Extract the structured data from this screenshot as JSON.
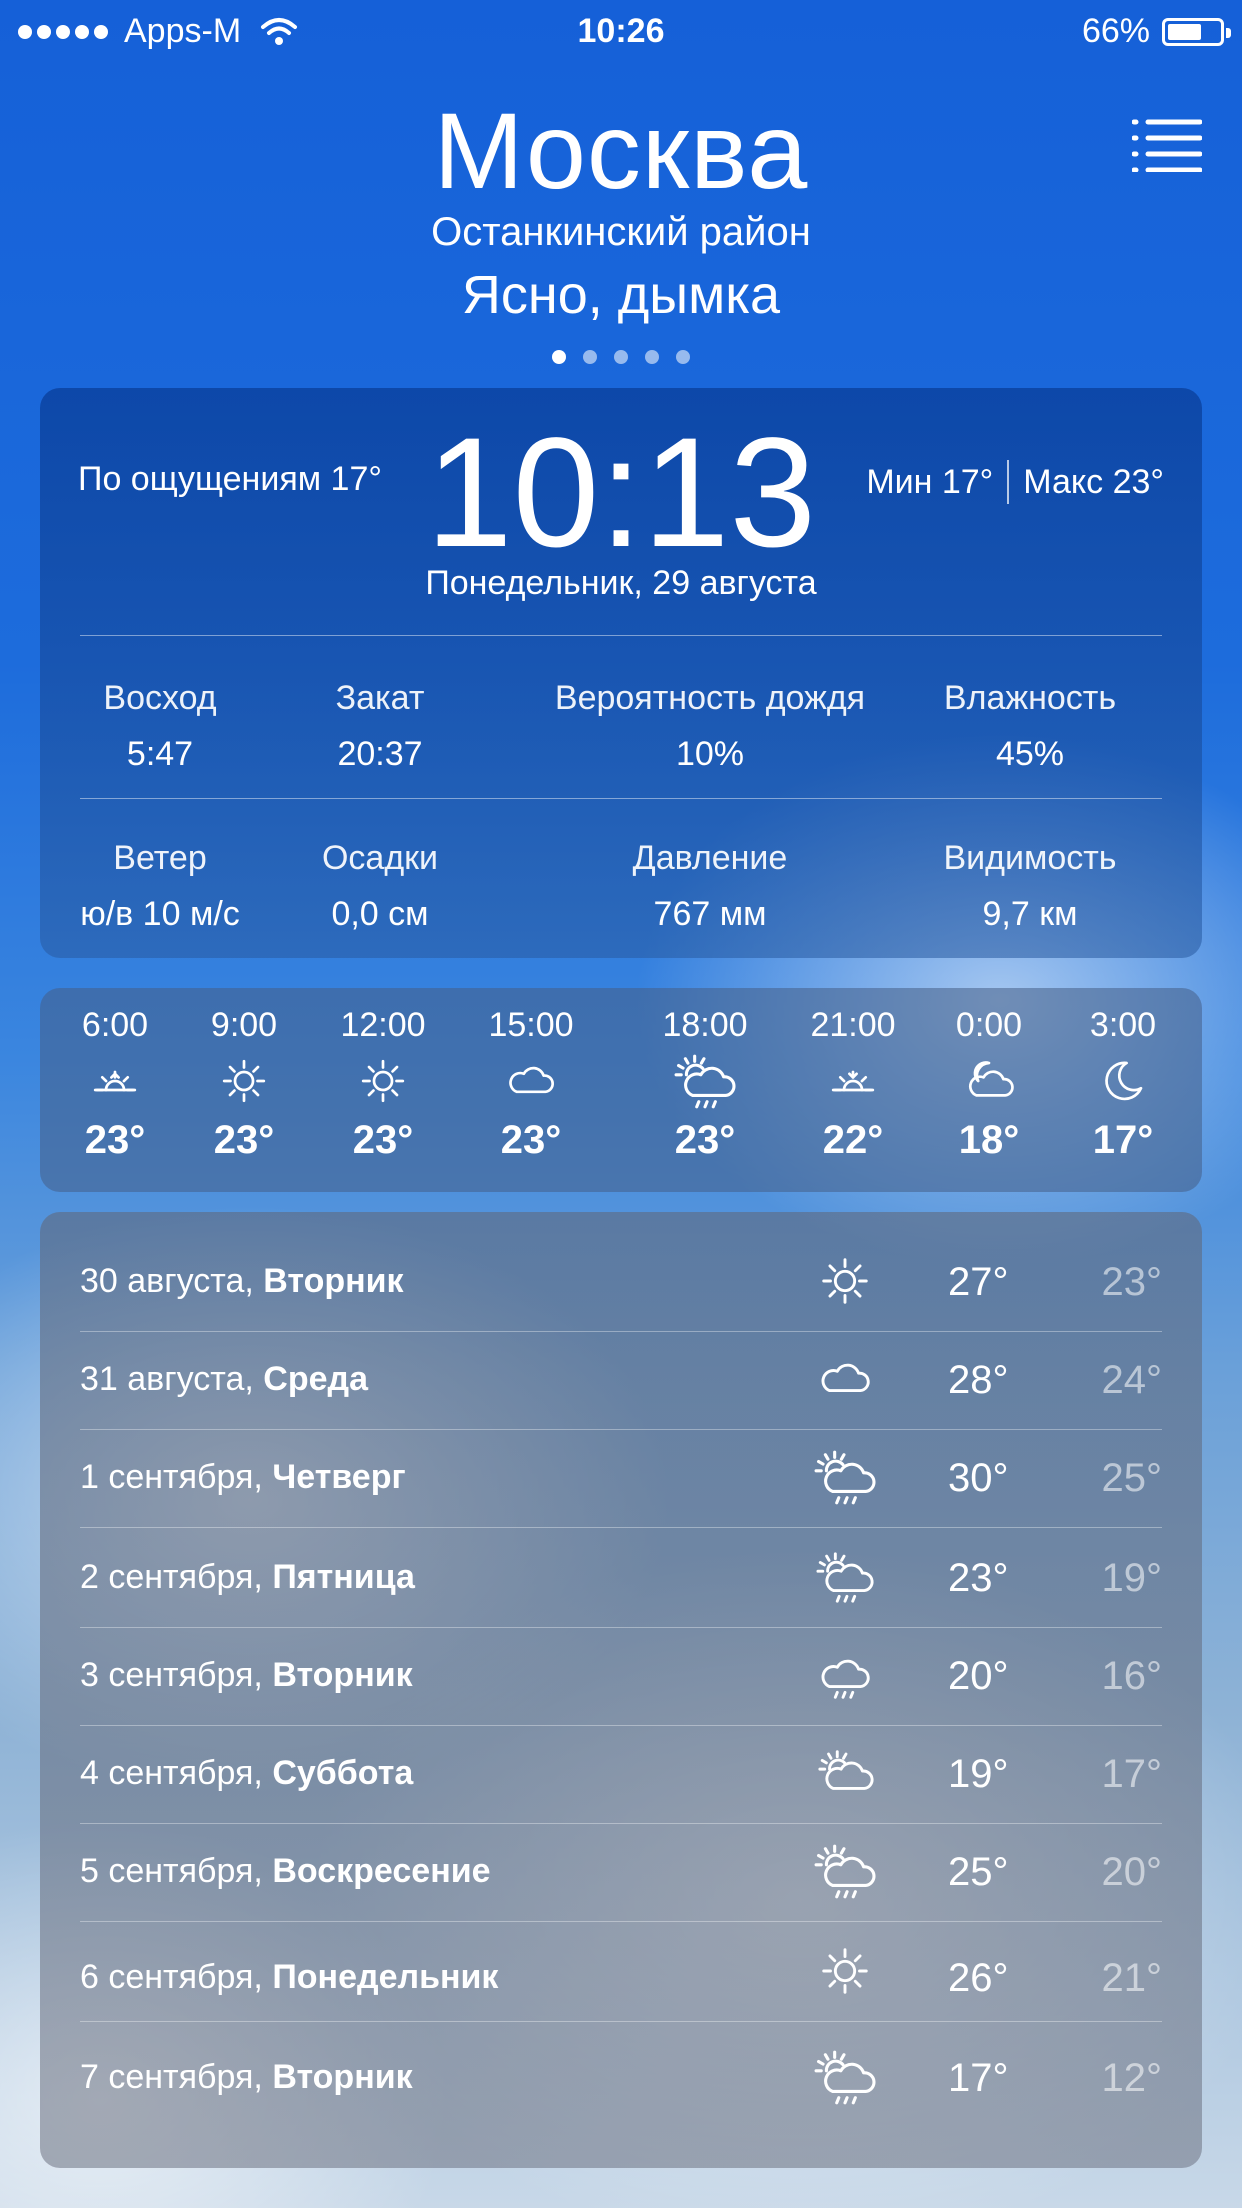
{
  "status_bar": {
    "carrier": "Apps-M",
    "time": "10:26",
    "battery": "66%",
    "battery_level": 0.66
  },
  "header": {
    "city": "Москва",
    "district": "Останкинский район",
    "condition": "Ясно, дымка",
    "pages": 5,
    "active_page": 0
  },
  "current": {
    "feels_like": "По ощущениям 17°",
    "time": "10:13",
    "min": "Мин 17°",
    "max": "Макс 23°",
    "date": "Понедельник, 29 августа",
    "stats_row1": [
      {
        "label": "Восход",
        "value": "5:47"
      },
      {
        "label": "Закат",
        "value": "20:37"
      },
      {
        "label": "Вероятность дождя",
        "value": "10%"
      },
      {
        "label": "Влажность",
        "value": "45%"
      }
    ],
    "stats_row2": [
      {
        "label": "Ветер",
        "value": "ю/в 10 м/с"
      },
      {
        "label": "Осадки",
        "value": "0,0 см"
      },
      {
        "label": "Давление",
        "value": "767 мм"
      },
      {
        "label": "Видимость",
        "value": "9,7 км"
      }
    ]
  },
  "hourly": [
    {
      "time": "6:00",
      "icon": "sunrise-icon",
      "temp": "23°"
    },
    {
      "time": "9:00",
      "icon": "sun-icon",
      "temp": "23°"
    },
    {
      "time": "12:00",
      "icon": "sun-icon",
      "temp": "23°"
    },
    {
      "time": "15:00",
      "icon": "cloud-icon",
      "temp": "23°"
    },
    {
      "time": "18:00",
      "icon": "sun-cloud-rain-icon",
      "temp": "23°"
    },
    {
      "time": "21:00",
      "icon": "sunset-icon",
      "temp": "22°"
    },
    {
      "time": "0:00",
      "icon": "moon-cloud-icon",
      "temp": "18°"
    },
    {
      "time": "3:00",
      "icon": "moon-icon",
      "temp": "17°"
    }
  ],
  "daily": [
    {
      "date": "30 августа,",
      "weekday": "Вторник",
      "icon": "sun-icon",
      "max": "27°",
      "min": "23°"
    },
    {
      "date": "31 августа,",
      "weekday": "Среда",
      "icon": "cloud-icon",
      "max": "28°",
      "min": "24°"
    },
    {
      "date": "1 сентября,",
      "weekday": "Четверг",
      "icon": "sun-cloud-rain-icon",
      "max": "30°",
      "min": "25°"
    },
    {
      "date": "2 сентября,",
      "weekday": "Пятница",
      "icon": "sun-cloud-rain-icon",
      "max": "23°",
      "min": "19°"
    },
    {
      "date": "3 сентября,",
      "weekday": "Вторник",
      "icon": "cloud-rain-icon",
      "max": "20°",
      "min": "16°"
    },
    {
      "date": "4 сентября,",
      "weekday": "Суббота",
      "icon": "sun-cloud-icon",
      "max": "19°",
      "min": "17°"
    },
    {
      "date": "5 сентября,",
      "weekday": "Воскресение",
      "icon": "sun-cloud-rain-icon",
      "max": "25°",
      "min": "20°"
    },
    {
      "date": "6 сентября,",
      "weekday": "Понедельник",
      "icon": "sun-icon",
      "max": "26°",
      "min": "21°"
    },
    {
      "date": "7 сентября,",
      "weekday": "Вторник",
      "icon": "sun-cloud-rain-icon",
      "max": "17°",
      "min": "12°"
    }
  ]
}
